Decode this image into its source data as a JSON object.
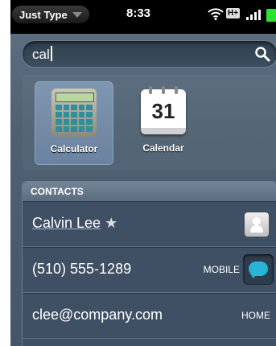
{
  "status": {
    "app_name": "Just Type",
    "time": "8:33",
    "network_label": "H+"
  },
  "search": {
    "query": "cal"
  },
  "apps": [
    {
      "label": "Calculator",
      "icon": "calculator-icon",
      "selected": true
    },
    {
      "label": "Calendar",
      "icon": "calendar-icon",
      "calendar_day": "31",
      "selected": false
    }
  ],
  "contacts": {
    "header": "CONTACTS",
    "name": "Calvin Lee",
    "favorite_symbol": "★",
    "phone": "(510) 555-1289",
    "phone_type": "MOBILE",
    "email": "clee@company.com",
    "email_type": "HOME"
  },
  "colors": {
    "accent_chat": "#27b4d6",
    "battery": "#30e030"
  }
}
